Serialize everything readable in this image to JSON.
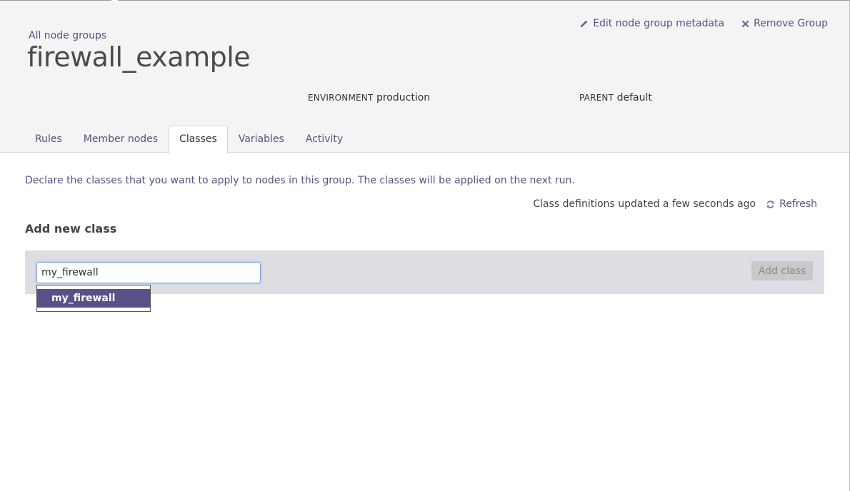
{
  "header": {
    "breadcrumb": "All node groups",
    "title": "firewall_example",
    "actions": {
      "edit_label": "Edit node group metadata",
      "remove_label": "Remove Group"
    },
    "environment": {
      "key": "ENVIRONMENT",
      "value": "production"
    },
    "parent": {
      "key": "PARENT",
      "value": "default"
    }
  },
  "tabs": [
    {
      "label": "Rules"
    },
    {
      "label": "Member nodes"
    },
    {
      "label": "Classes",
      "active": true
    },
    {
      "label": "Variables"
    },
    {
      "label": "Activity"
    }
  ],
  "classes": {
    "description": "Declare the classes that you want to apply to nodes in this group. The classes will be applied on the next run.",
    "refresh_status": "Class definitions updated a few seconds ago",
    "refresh_label": "Refresh",
    "section_heading": "Add new class",
    "input_value": "my_firewall",
    "add_button_label": "Add class",
    "suggestions": [
      "my_firewall"
    ]
  },
  "icons": {
    "edit": "pencil-icon",
    "remove": "close-icon",
    "refresh": "refresh-icon"
  },
  "colors": {
    "link": "#5a4f82",
    "header_bg": "#f4f4f4",
    "panel_bg": "#dddde4",
    "suggestion_bg": "#5a5189"
  }
}
